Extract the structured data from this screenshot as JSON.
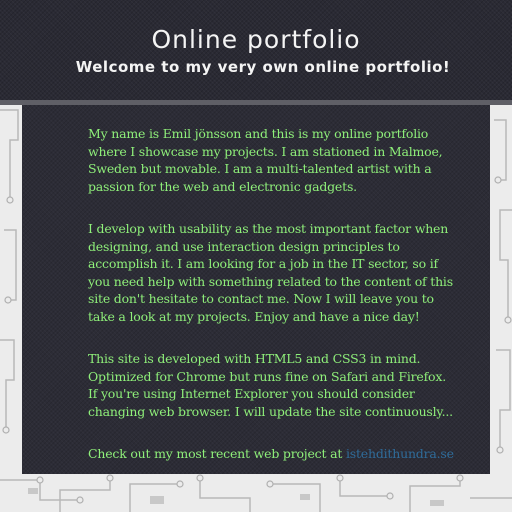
{
  "header": {
    "title": "Online portfolio",
    "subtitle": "Welcome to my very own online portfolio!"
  },
  "main": {
    "paragraphs": [
      "My name is Emil jönsson and this is my online portfolio where I showcase my projects. I am stationed in Malmoe, Sweden but movable. I am a multi-talented artist with a passion for the web and electronic gadgets.",
      "I develop with usability as the most important factor when designing, and use interaction design principles to accomplish it. I am looking for a job in the IT sector, so if you need help with something related to the content of this site don't hesitate to contact me. Now I will leave you to take a look at my projects. Enjoy and have a nice day!",
      "This site is developed with HTML5 and CSS3 in mind. Optimized for Chrome but runs fine on Safari and Firefox. If you're using Internet Explorer you should consider changing web browser. I will update the site continuously..."
    ],
    "recent_project_text": "Check out my most recent web project at ",
    "recent_project_link": "istehdithundra.se"
  },
  "colors": {
    "body_text": "#8ff07a",
    "link": "#2f6c9a",
    "panel": "#2c2c36",
    "background": "#ececec",
    "divider": "#5f5f66"
  }
}
